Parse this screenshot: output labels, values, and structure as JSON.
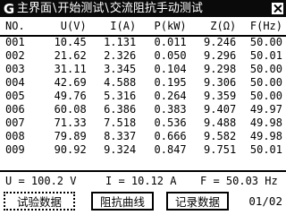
{
  "titlebar": {
    "logo": "G",
    "crumbs": [
      "主界面",
      "开始测试",
      "交流阻抗手动测试"
    ],
    "separator": "\\"
  },
  "table": {
    "headers": [
      "NO.",
      "U(V)",
      "I(A)",
      "P(kW)",
      "Z(Ω)",
      "F(Hz)"
    ],
    "rows": [
      [
        "001",
        "10.45",
        "1.131",
        "0.011",
        "9.246",
        "50.00"
      ],
      [
        "002",
        "21.62",
        "2.326",
        "0.050",
        "9.296",
        "50.01"
      ],
      [
        "003",
        "31.11",
        "3.345",
        "0.104",
        "9.298",
        "50.00"
      ],
      [
        "004",
        "42.69",
        "4.588",
        "0.195",
        "9.306",
        "50.00"
      ],
      [
        "005",
        "49.76",
        "5.316",
        "0.264",
        "9.359",
        "50.00"
      ],
      [
        "006",
        "60.08",
        "6.386",
        "0.383",
        "9.407",
        "49.97"
      ],
      [
        "007",
        "71.33",
        "7.518",
        "0.536",
        "9.488",
        "49.98"
      ],
      [
        "008",
        "79.89",
        "8.337",
        "0.666",
        "9.582",
        "49.98"
      ],
      [
        "009",
        "90.92",
        "9.324",
        "0.847",
        "9.751",
        "50.01"
      ]
    ]
  },
  "readout": {
    "voltage": "U = 100.2 V",
    "current": "I = 10.12 A",
    "frequency": "F = 50.03 Hz"
  },
  "buttons": {
    "test_data": "试验数据",
    "impedance_curve": "阻抗曲线",
    "record_data": "记录数据"
  },
  "pagination": "01/02"
}
